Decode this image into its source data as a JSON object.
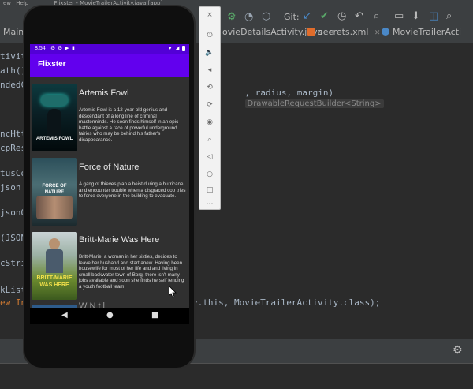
{
  "ide": {
    "menu_items": [
      "ew",
      "Help",
      "Flixster - MovieTrailerActivity.java [app]"
    ],
    "tabs": [
      {
        "label": "MainActi",
        "color": "#4a88c7"
      },
      {
        "label": "ovieDetailsActivity.java",
        "color": "#4a88c7"
      },
      {
        "label": "secrets.xml",
        "color": "#e06c2b"
      },
      {
        "label": "MovieTrailerActi",
        "color": "#4a88c7"
      }
    ],
    "code_lines": [
      {
        "text": "tivit"
      },
      {
        "text": "ath())"
      },
      {
        "text": "ndedCo"
      },
      {
        "text": "ncHttp"
      },
      {
        "text": "cpResp"
      },
      {
        "text": "tusCo"
      },
      {
        "text": "json.j"
      },
      {
        "text": "jsonOb"
      },
      {
        "text": "(JSONO"
      },
      {
        "text": "cStrin"
      },
      {
        "text": "kListe"
      },
      {
        "text": "ew Int"
      }
    ],
    "code_right_1": ", radius, margin)",
    "code_hint_1": "DrawableRequestBuilder<String>",
    "code_right_2": "y.this, MovieTrailerActivity.class);",
    "git_label": "Git:"
  },
  "phone": {
    "status_time": "8:54",
    "app_title": "Flixster",
    "movies": [
      {
        "title": "Artemis Fowl",
        "overview": "Artemis Fowl is a 12-year-old genius and descendant of a long line of criminal masterminds. He soon finds himself in an epic battle against a race of powerful underground fairies who may be behind his father's disappearance.",
        "poster_text": "ARTEMIS FOWL"
      },
      {
        "title": "Force of Nature",
        "overview": "A gang of thieves plan a heist during a hurricane and encounter trouble when a disgraced cop tries to force everyone in the building to evacuate.",
        "poster_text": "FORCE OF NATURE"
      },
      {
        "title": "Britt-Marie Was Here",
        "overview": "Britt-Marie, a woman in her sixties, decides to leave her husband and start anew. Having been housewife for most of her life and and living in small backwater town of Borg, there isn't many jobs available and soon she finds herself fending a youth football team.",
        "poster_text": "BRITT-MARIE WAS HERE"
      }
    ],
    "partial_title": "W    N t      l"
  },
  "colors": {
    "purple_primary": "#6200ee",
    "purple_dark": "#5200d6",
    "list_bg": "#303030"
  }
}
